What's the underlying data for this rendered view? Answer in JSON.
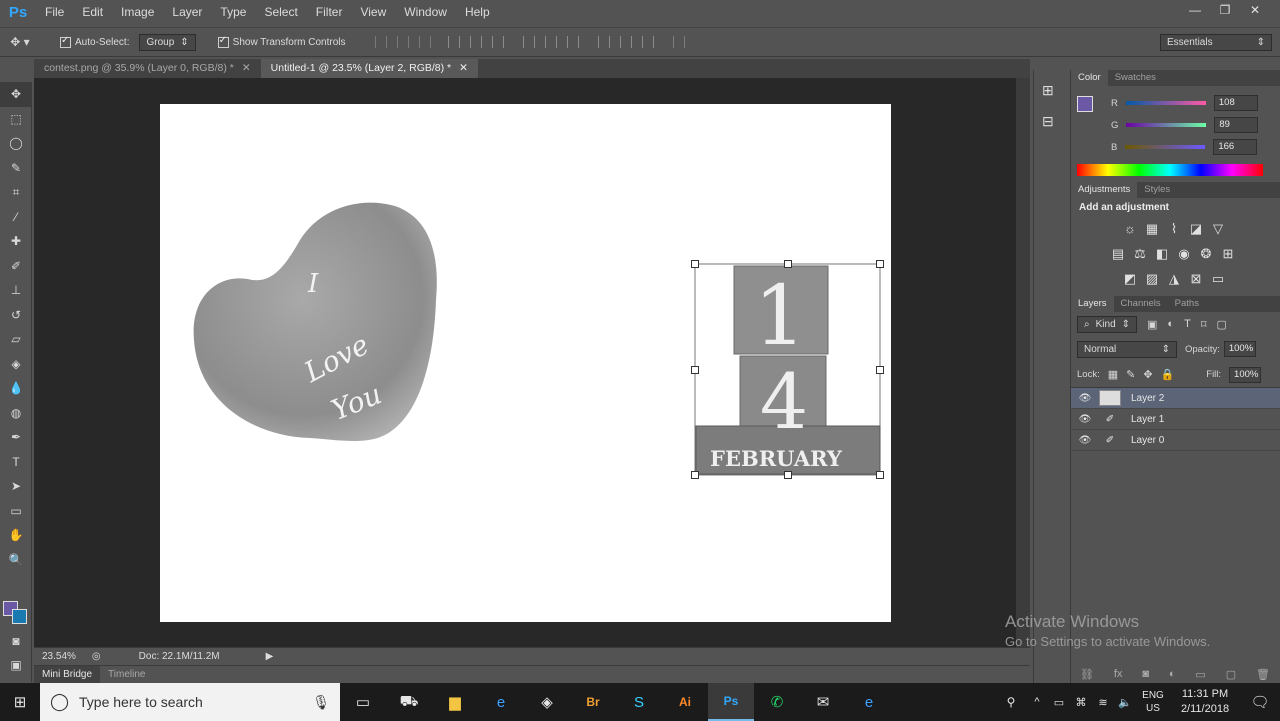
{
  "app": {
    "logo": "Ps"
  },
  "menu": [
    "File",
    "Edit",
    "Image",
    "Layer",
    "Type",
    "Select",
    "Filter",
    "View",
    "Window",
    "Help"
  ],
  "window_controls": {
    "minimize": "—",
    "restore": "❐",
    "close": "✕"
  },
  "options": {
    "auto_select_label": "Auto-Select:",
    "auto_select_value": "Group",
    "show_transform_label": "Show Transform Controls",
    "workspace": "Essentials"
  },
  "tabs": [
    {
      "title": "contest.png @ 35.9% (Layer 0, RGB/8) *",
      "close": "✕"
    },
    {
      "title": "Untitled-1 @ 23.5% (Layer 2, RGB/8) *",
      "close": "✕"
    }
  ],
  "artwork": {
    "heart_text_line1": "I",
    "heart_text_line2": "Love",
    "heart_text_line3": "You",
    "block_top_digit": "1",
    "block_bottom_digit": "4",
    "block_base_text": "FEBRUARY"
  },
  "status": {
    "zoom": "23.54%",
    "doc": "Doc: 22.1M/11.2M"
  },
  "bottom_tabs": [
    "Mini Bridge",
    "Timeline"
  ],
  "color_panel": {
    "tabs": [
      "Color",
      "Swatches"
    ],
    "r_label": "R",
    "r_value": "108",
    "g_label": "G",
    "g_value": "89",
    "b_label": "B",
    "b_value": "166",
    "foreground": "#6c59a6",
    "background": "#1a7ab0"
  },
  "adjustments_panel": {
    "tabs": [
      "Adjustments",
      "Styles"
    ],
    "heading": "Add an adjustment"
  },
  "layers_panel": {
    "tabs": [
      "Layers",
      "Channels",
      "Paths"
    ],
    "kind_label": "Kind",
    "blend_mode": "Normal",
    "opacity_label": "Opacity:",
    "opacity_value": "100%",
    "lock_label": "Lock:",
    "fill_label": "Fill:",
    "fill_value": "100%",
    "layers": [
      {
        "name": "Layer 2",
        "selected": true
      },
      {
        "name": "Layer 1",
        "selected": false
      },
      {
        "name": "Layer 0",
        "selected": false
      }
    ]
  },
  "watermark": {
    "title": "Activate Windows",
    "subtitle": "Go to Settings to activate Windows."
  },
  "taskbar": {
    "search_placeholder": "Type here to search",
    "lang_top": "ENG",
    "lang_bottom": "US",
    "time": "11:31 PM",
    "date": "2/11/2018"
  }
}
